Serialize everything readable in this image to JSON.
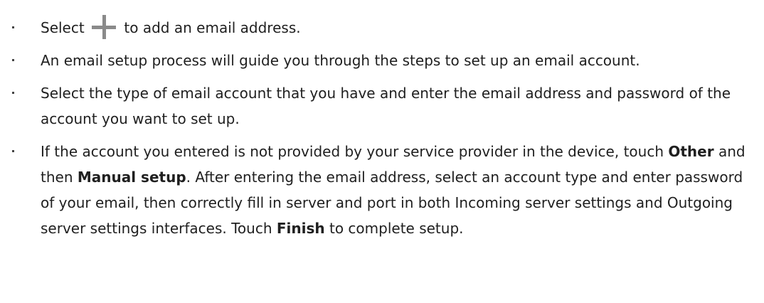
{
  "bullets": {
    "item1": {
      "prefix": "Select",
      "icon": "plus-icon",
      "suffix": "to add an email address."
    },
    "item2": {
      "text": "An email setup process will guide you through the steps to set up an email account."
    },
    "item3": {
      "text": "Select the type of email account that you have and enter the email address and password of the account you want to set up."
    },
    "item4": {
      "part1": "If the account you entered is not provided by your service provider in the device, touch ",
      "bold1": "Other",
      "part2": " and then ",
      "bold2": "Manual setup",
      "part3": ". After entering the email address, select an account type and enter password of your email, then correctly fill in server and port in both Incoming server settings and Outgoing server settings interfaces. Touch ",
      "bold3": "Finish",
      "part4": " to complete setup."
    }
  }
}
